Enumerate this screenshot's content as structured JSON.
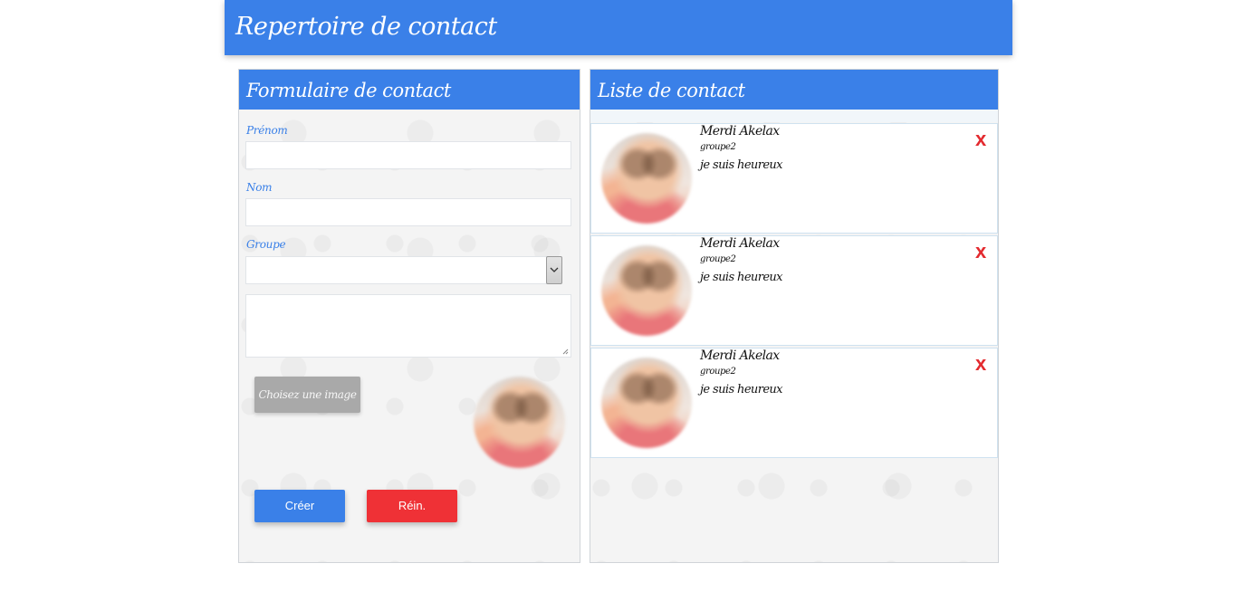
{
  "app": {
    "title": "Repertoire de contact",
    "accent_color": "#3a80e8",
    "danger_color": "#ef3136"
  },
  "form": {
    "title": "Formulaire de contact",
    "first_name_label": "Prénom",
    "first_name_value": "",
    "last_name_label": "Nom",
    "last_name_value": "",
    "group_label": "Groupe",
    "group_selected": "",
    "bio_value": "",
    "choose_image_label": "Choisez une image",
    "preview_icon": "baby-photo",
    "create_label": "Créer",
    "reset_label": "Réin."
  },
  "list": {
    "title": "Liste de contact",
    "delete_glyph": "x",
    "contacts": [
      {
        "name": "Merdi Akelax",
        "group": "groupe2",
        "note": "je suis heureux",
        "avatar": "baby-photo"
      },
      {
        "name": "Merdi Akelax",
        "group": "groupe2",
        "note": "je suis heureux",
        "avatar": "baby-photo"
      },
      {
        "name": "Merdi Akelax",
        "group": "groupe2",
        "note": "je suis heureux",
        "avatar": "baby-photo"
      }
    ]
  }
}
